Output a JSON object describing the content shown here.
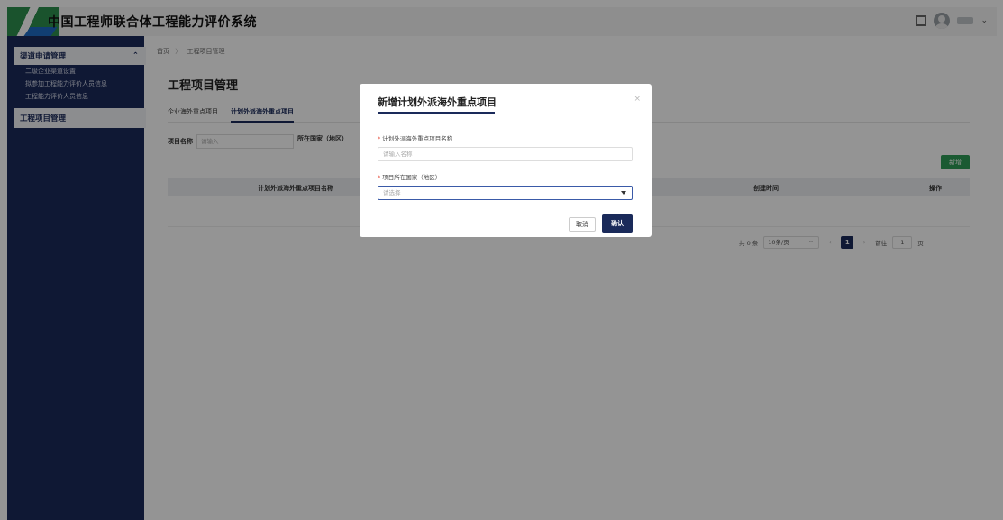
{
  "app": {
    "title": "中国工程师联合体工程能力评价系统"
  },
  "sidebar": {
    "group": {
      "label": "渠道申请管理",
      "toggle": "⌃"
    },
    "sub_items": [
      {
        "label": "二级企业渠道设置"
      },
      {
        "label": "拟参加工程能力评价人员信息"
      },
      {
        "label": "工程能力评价人员信息"
      }
    ],
    "item2": {
      "label": "工程项目管理"
    }
  },
  "breadcrumb": {
    "home": "首页",
    "sep": "〉",
    "current": "工程项目管理"
  },
  "page": {
    "title": "工程项目管理",
    "tabs": [
      {
        "label": "企业海外重点项目"
      },
      {
        "label": "计划外派海外重点项目"
      }
    ],
    "filter": {
      "name_label": "项目名称",
      "name_placeholder": "请输入",
      "country_label": "所在国家（地区）"
    },
    "add_label": "新增",
    "table": {
      "columns": [
        {
          "label": "计划外派海外重点项目名称"
        },
        {
          "label": "创建时间"
        },
        {
          "label": "操作"
        }
      ],
      "rows": []
    },
    "pager": {
      "total": "共 0 条",
      "page_size": "10条/页",
      "prev": "‹",
      "current": "1",
      "next": "›",
      "goto_label": "前往",
      "goto_value": "1",
      "page_unit": "页"
    }
  },
  "modal": {
    "title": "新增计划外派海外重点项目",
    "close": "×",
    "field1": {
      "required": "*",
      "label": "计划外派海外重点项目名称",
      "placeholder": "请输入名称"
    },
    "field2": {
      "required": "*",
      "label": "项目所在国家（地区）",
      "placeholder": "请选择"
    },
    "cancel": "取消",
    "confirm": "确认"
  }
}
